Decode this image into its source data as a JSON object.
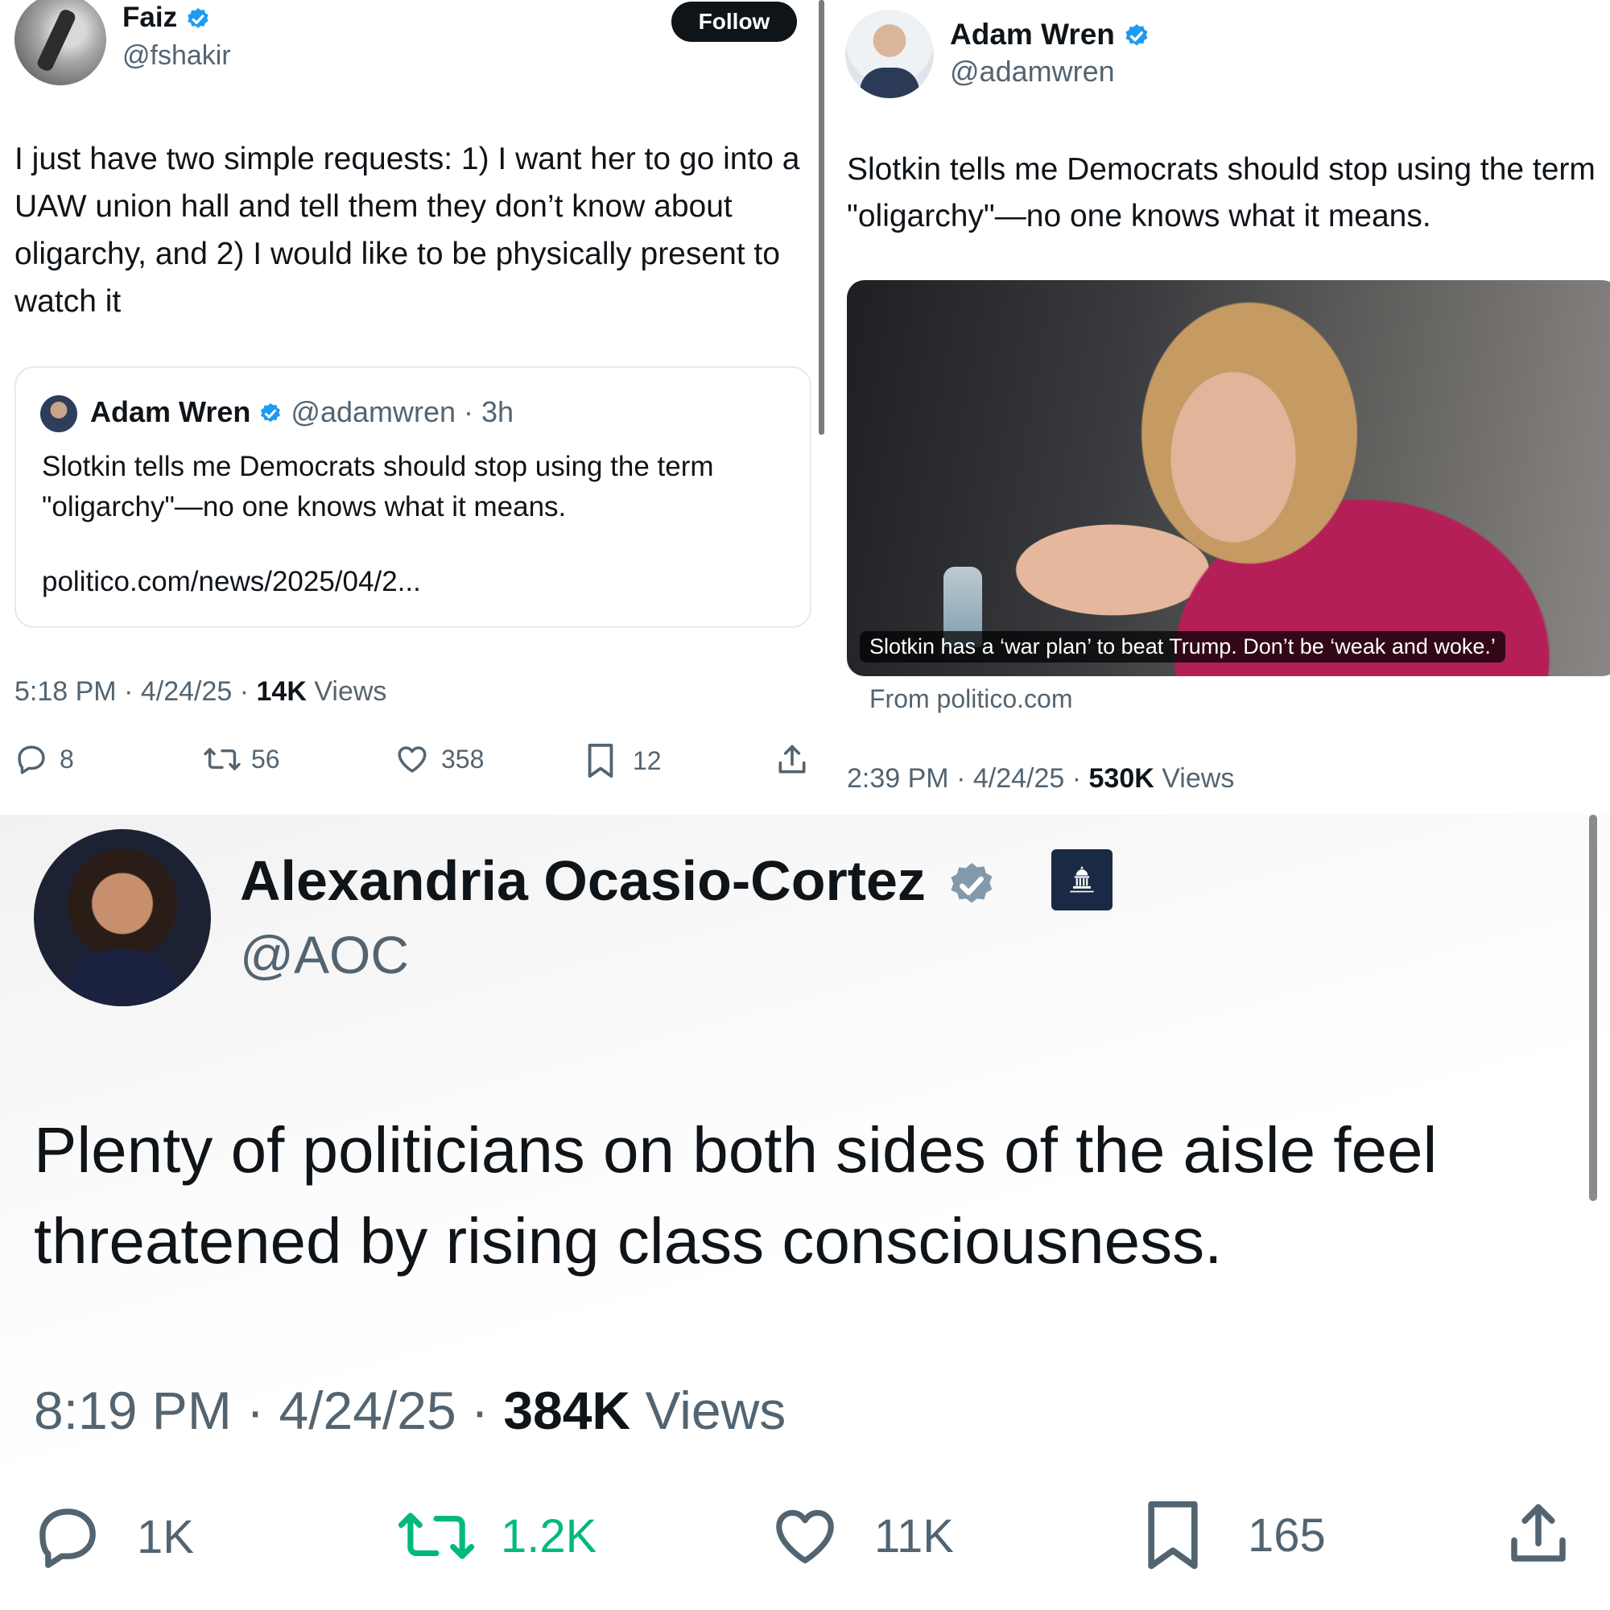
{
  "faiz_tweet": {
    "name": "Faiz",
    "handle": "@fshakir",
    "follow_label": "Follow",
    "text": "I just have two simple requests: 1) I want her to go into a UAW union hall and tell them they don’t know about oligarchy, and 2) I would like to be physically present to watch it",
    "quote": {
      "name": "Adam Wren",
      "handle_time": "@adamwren · 3h",
      "text": "Slotkin tells me Democrats should stop using the term \"oligarchy\"—no one knows what it means.",
      "link": "politico.com/news/2025/04/2..."
    },
    "timestamp": "5:18 PM · 4/24/25 · ",
    "views_count": "14K",
    "views_label": "Views",
    "stats": {
      "replies": "8",
      "reposts": "56",
      "likes": "358",
      "bookmarks": "12"
    }
  },
  "wren_tweet": {
    "name": "Adam Wren",
    "handle": "@adamwren",
    "text": "Slotkin tells me Democrats should stop using the term \"oligarchy\"—no one knows what it means.",
    "media_caption": "Slotkin has a ‘war plan’ to beat Trump. Don’t be ‘weak and woke.’",
    "source": "From politico.com",
    "timestamp": "2:39 PM · 4/24/25 · ",
    "views_count": "530K",
    "views_label": "Views"
  },
  "aoc_tweet": {
    "name": "Alexandria Ocasio-Cortez",
    "handle": "@AOC",
    "text": "Plenty of politicians on both sides of the aisle feel threatened by rising class consciousness.",
    "timestamp": "8:19 PM · 4/24/25 · ",
    "views_count": "384K",
    "views_label": "Views",
    "stats": {
      "replies": "1K",
      "reposts": "1.2K",
      "likes": "11K",
      "bookmarks": "165"
    }
  },
  "colors": {
    "verified_blue": "#1d9bf0",
    "verified_gray": "#829aab",
    "repost_green": "#00ba7c",
    "text_primary": "#0f1419",
    "text_secondary": "#536471"
  },
  "icons": [
    "verified-badge-icon",
    "reply-icon",
    "repost-icon",
    "like-icon",
    "bookmark-icon",
    "share-icon",
    "government-badge-icon"
  ]
}
